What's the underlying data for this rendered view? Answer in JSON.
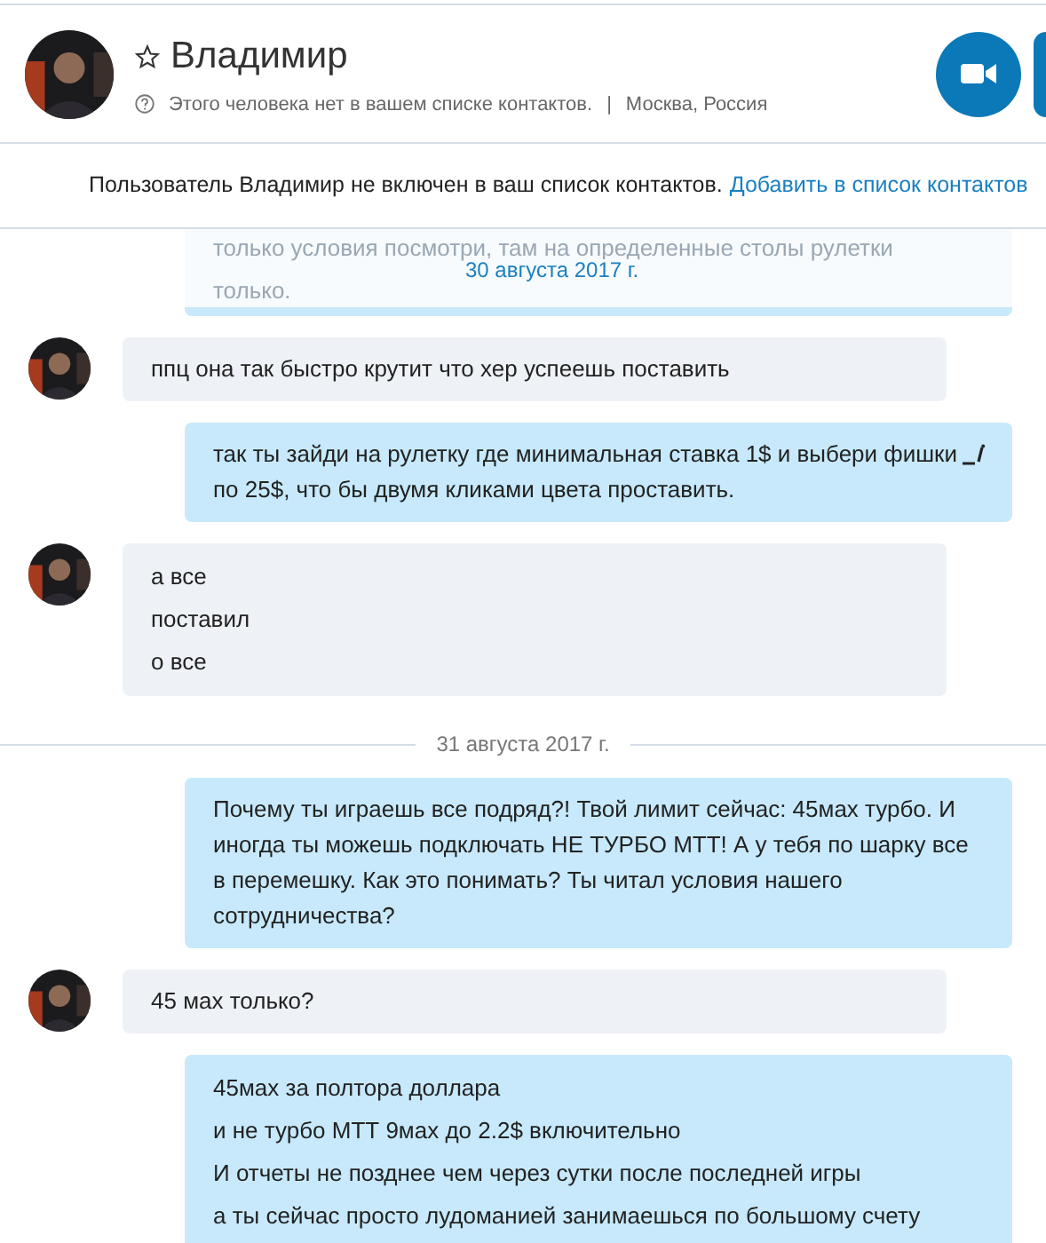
{
  "contact": {
    "name": "Владимир",
    "favorite": false,
    "status": "Этого человека нет в вашем списке контактов.",
    "separator": "|",
    "location": "Москва, Россия"
  },
  "notice": {
    "text": "Пользователь Владимир не включен в ваш список контактов.",
    "link": "Добавить в список контактов"
  },
  "messages": [
    {
      "kind": "partial",
      "lines": [
        "только условия посмотри, там на определенные столы рулетки",
        "только."
      ],
      "date": "30 августа 2017 г."
    },
    {
      "kind": "incoming",
      "lines": [
        "ппц она так быстро крутит что хер успеешь поставить"
      ]
    },
    {
      "kind": "outgoing",
      "edited": true,
      "lines": [
        "так ты зайди на рулетку где минимальная ставка 1$ и выбери фишки по 25$, что бы двумя кликами цвета проставить."
      ]
    },
    {
      "kind": "incoming",
      "lines": [
        "а все",
        "поставил",
        "о все"
      ]
    },
    {
      "kind": "date",
      "text": "31 августа 2017 г."
    },
    {
      "kind": "outgoing",
      "edited": false,
      "lines": [
        "Почему ты играешь все подряд?! Твой лимит сейчас: 45мах турбо. И иногда ты можешь подключать НЕ ТУРБО МТТ! А у тебя по шарку все в перемешку. Как это понимать? Ты читал условия нашего сотрудничества?"
      ]
    },
    {
      "kind": "incoming",
      "lines": [
        "45 мах только?"
      ]
    },
    {
      "kind": "outgoing",
      "edited": false,
      "lines": [
        "45мах за полтора доллара",
        "и не турбо МТТ 9мах до 2.2$ включительно",
        "И отчеты не позднее чем через сутки после последней игры",
        "а ты сейчас просто лудоманией занимаешься по большому счету"
      ]
    }
  ]
}
